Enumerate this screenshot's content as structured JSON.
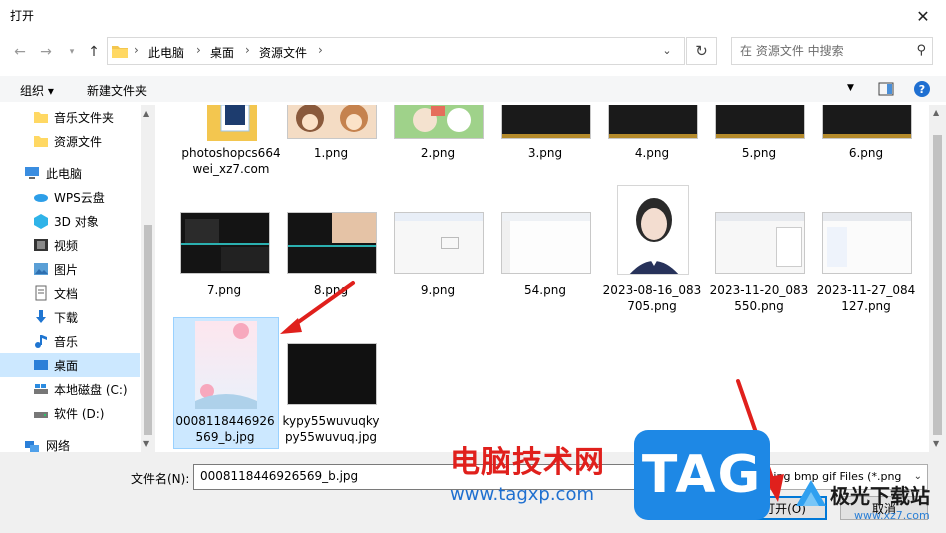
{
  "window": {
    "title": "打开",
    "close_glyph": "✕"
  },
  "nav": {
    "back_icon": "back-arrow-icon",
    "forward_icon": "forward-arrow-icon",
    "recent_icon": "chevron-down-icon",
    "up_icon": "up-arrow-icon",
    "breadcrumbs": [
      "此电脑",
      "桌面",
      "资源文件"
    ],
    "search_placeholder": "在 资源文件 中搜索"
  },
  "toolbar": {
    "organize": "组织 ▾",
    "new_folder": "新建文件夹"
  },
  "sidebar": {
    "items": [
      {
        "label": "音乐文件夹",
        "icon": "folder-icon"
      },
      {
        "label": "资源文件",
        "icon": "folder-icon"
      },
      {
        "label": "此电脑",
        "icon": "computer-icon"
      },
      {
        "label": "WPS云盘",
        "icon": "cloud-icon"
      },
      {
        "label": "3D 对象",
        "icon": "cube-icon"
      },
      {
        "label": "视频",
        "icon": "video-icon"
      },
      {
        "label": "图片",
        "icon": "picture-icon"
      },
      {
        "label": "文档",
        "icon": "document-icon"
      },
      {
        "label": "下载",
        "icon": "download-icon"
      },
      {
        "label": "音乐",
        "icon": "music-icon"
      },
      {
        "label": "桌面",
        "icon": "desktop-icon"
      },
      {
        "label": "本地磁盘 (C:)",
        "icon": "drive-icon"
      },
      {
        "label": "软件 (D:)",
        "icon": "drive-icon"
      },
      {
        "label": "网络",
        "icon": "network-icon"
      }
    ]
  },
  "files": [
    {
      "name": "photoshopcs664wei_xz7.com"
    },
    {
      "name": "1.png"
    },
    {
      "name": "2.png"
    },
    {
      "name": "3.png"
    },
    {
      "name": "4.png"
    },
    {
      "name": "5.png"
    },
    {
      "name": "6.png"
    },
    {
      "name": "7.png"
    },
    {
      "name": "8.png"
    },
    {
      "name": "9.png"
    },
    {
      "name": "54.png"
    },
    {
      "name": "2023-08-16_083705.png"
    },
    {
      "name": "2023-11-20_083550.png"
    },
    {
      "name": "2023-11-27_084127.png"
    },
    {
      "name": "0008118446926569_b.jpg"
    },
    {
      "name": "kypy55wuvuqkypy55wuvuq.jpg"
    }
  ],
  "footer": {
    "filename_label": "文件名(N):",
    "filename_value": "0008118446926569_b.jpg",
    "filter_value": "png jpg bmp gif Files (*.png",
    "open_label": "打开(O)",
    "cancel_label": "取消"
  },
  "watermark": {
    "site_name": "电脑技术网",
    "site_url": "www.tagxp.com",
    "tag_logo": "TAG",
    "brand2": "极光下载站",
    "brand2_url": "www.xz7.com"
  },
  "colors": {
    "accent": "#0078d7",
    "selected_bg": "#cce8ff",
    "arrow_red": "#e0201c",
    "tag_blue": "#1e88e5"
  }
}
